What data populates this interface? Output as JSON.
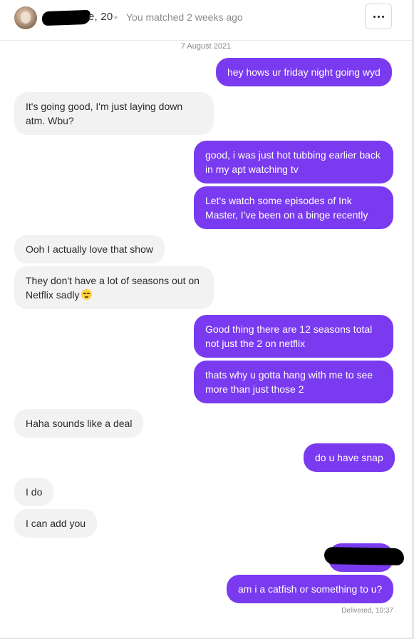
{
  "header": {
    "name_suffix": "e, 20",
    "matched_text": "You matched 2 weeks ago",
    "more_icon": "more-horizontal-icon"
  },
  "date_separator": "7 August 2021",
  "messages": [
    {
      "side": "out",
      "text": "hey hows ur friday night going wyd"
    },
    {
      "side": "in",
      "lines": [
        "It's going good, I'm just laying down",
        "atm. Wbu?"
      ]
    },
    {
      "side": "out",
      "lines": [
        "good, i was just hot tubbing earlier back",
        "in my apt watching tv"
      ]
    },
    {
      "side": "out",
      "lines": [
        "Let's watch some episodes of Ink",
        "Master, I've been on a binge recently"
      ]
    },
    {
      "side": "in",
      "text": "Ooh I actually love that show"
    },
    {
      "side": "in",
      "lines": [
        "They don't have a lot of seasons out on",
        "Netflix sadly"
      ],
      "emoji": "pensive-face-emoji"
    },
    {
      "side": "out",
      "lines": [
        "Good thing there are 12 seasons total",
        "not just the 2 on netflix"
      ]
    },
    {
      "side": "out",
      "lines": [
        "thats why u gotta hang with me to see",
        "more than just those 2"
      ]
    },
    {
      "side": "in",
      "text": "Haha sounds like a deal"
    },
    {
      "side": "out",
      "text": "do u have snap"
    },
    {
      "side": "in",
      "text": "I do"
    },
    {
      "side": "in",
      "text": "I can add you"
    },
    {
      "side": "out",
      "redacted": true
    },
    {
      "side": "out",
      "text": "am i a catfish or something to u?"
    }
  ],
  "status": "Delivered, 10:37",
  "colors": {
    "outgoing_bubble": "#7a3af0",
    "incoming_bubble": "#f2f2f2"
  }
}
